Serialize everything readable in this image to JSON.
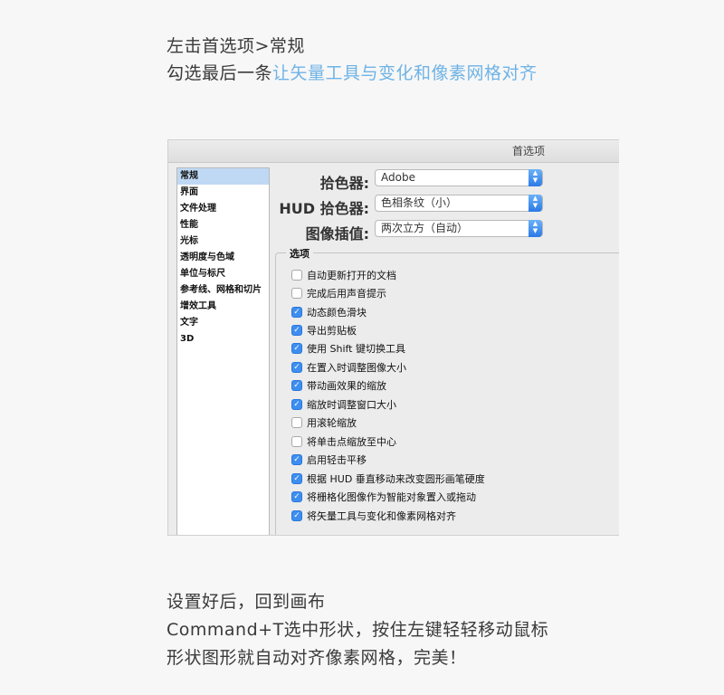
{
  "intro": {
    "line1": "左击首选项>常规",
    "line2_prefix": "勾选最后一条",
    "line2_highlight": "让矢量工具与变化和像素网格对齐"
  },
  "window": {
    "title": "首选项",
    "sidebar": [
      {
        "label": "常规",
        "selected": true
      },
      {
        "label": "界面"
      },
      {
        "label": "文件处理"
      },
      {
        "label": "性能"
      },
      {
        "label": "光标"
      },
      {
        "label": "透明度与色域"
      },
      {
        "label": "单位与标尺"
      },
      {
        "label": "参考线、网格和切片"
      },
      {
        "label": "增效工具"
      },
      {
        "label": "文字"
      },
      {
        "label": "3D"
      }
    ],
    "fields": {
      "color_picker_label": "拾色器:",
      "color_picker_value": "Adobe",
      "hud_label": "HUD 拾色器:",
      "hud_value": "色相条纹（小）",
      "interp_label": "图像插值:",
      "interp_value": "两次立方（自动）"
    },
    "options_legend": "选项",
    "options": [
      {
        "label": "自动更新打开的文档",
        "checked": false
      },
      {
        "label": "完成后用声音提示",
        "checked": false
      },
      {
        "label": "动态颜色滑块",
        "checked": true
      },
      {
        "label": "导出剪贴板",
        "checked": true
      },
      {
        "label": "使用 Shift 键切换工具",
        "checked": true
      },
      {
        "label": "在置入时调整图像大小",
        "checked": true
      },
      {
        "label": "带动画效果的缩放",
        "checked": true
      },
      {
        "label": "缩放时调整窗口大小",
        "checked": true
      },
      {
        "label": "用滚轮缩放",
        "checked": false
      },
      {
        "label": "将单击点缩放至中心",
        "checked": false
      },
      {
        "label": "启用轻击平移",
        "checked": true
      },
      {
        "label": "根据 HUD 垂直移动来改变圆形画笔硬度",
        "checked": true
      },
      {
        "label": "将栅格化图像作为智能对象置入或拖动",
        "checked": true
      },
      {
        "label": "将矢量工具与变化和像素网格对齐",
        "checked": true
      }
    ]
  },
  "outro": {
    "line1": "设置好后，回到画布",
    "line2": "Command+T选中形状，按住左键轻轻移动鼠标",
    "line3": "形状图形就自动对齐像素网格，完美！"
  },
  "colors": {
    "highlight": "#6fb3e6",
    "checkbox": "#3d8ef0",
    "selection": "#bfd9f5"
  }
}
